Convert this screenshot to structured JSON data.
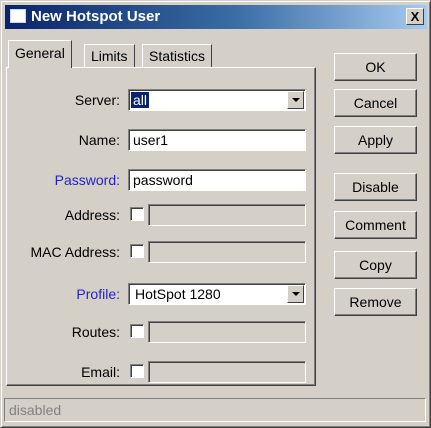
{
  "window": {
    "title": "New Hotspot User",
    "close_label": "X"
  },
  "tabs": [
    {
      "label": "General",
      "active": true
    },
    {
      "label": "Limits",
      "active": false
    },
    {
      "label": "Statistics",
      "active": false
    }
  ],
  "form": {
    "server": {
      "label": "Server:",
      "value": "all"
    },
    "name": {
      "label": "Name:",
      "value": "user1"
    },
    "password": {
      "label": "Password:",
      "value": "password"
    },
    "address": {
      "label": "Address:",
      "value": ""
    },
    "mac_address": {
      "label": "MAC Address:",
      "value": ""
    },
    "profile": {
      "label": "Profile:",
      "value": "HotSpot 1280"
    },
    "routes": {
      "label": "Routes:",
      "value": ""
    },
    "email": {
      "label": "Email:",
      "value": ""
    }
  },
  "buttons": {
    "ok": "OK",
    "cancel": "Cancel",
    "apply": "Apply",
    "disable": "Disable",
    "comment": "Comment",
    "copy": "Copy",
    "remove": "Remove"
  },
  "status": "disabled",
  "colors": {
    "title_bar": "#0a246a",
    "blue_label": "#2323c8",
    "face": "#d4d0c8"
  }
}
